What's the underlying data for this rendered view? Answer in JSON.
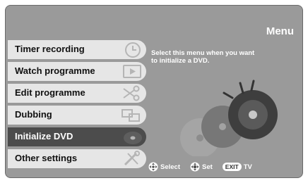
{
  "header": {
    "title": "Menu"
  },
  "menu": {
    "items": [
      {
        "label": "Timer recording",
        "icon": "clock-icon"
      },
      {
        "label": "Watch programme",
        "icon": "film-play-icon"
      },
      {
        "label": "Edit programme",
        "icon": "scissors-icon"
      },
      {
        "label": "Dubbing",
        "icon": "film-strip-icon"
      },
      {
        "label": "Initialize DVD",
        "icon": "disc-icon",
        "selected": true
      },
      {
        "label": "Other settings",
        "icon": "tools-icon"
      }
    ]
  },
  "description": {
    "line1": "Select this menu when you want",
    "line2": "to initialize a DVD."
  },
  "legend": {
    "select_label": "Select",
    "set_label": "Set",
    "exit_badge": "EXIT",
    "exit_label": "TV"
  },
  "colors": {
    "background": "#9a9a9a",
    "item_bg": "#e6e6e6",
    "item_selected_bg": "#4c4c4c",
    "text_light": "#ffffff"
  }
}
